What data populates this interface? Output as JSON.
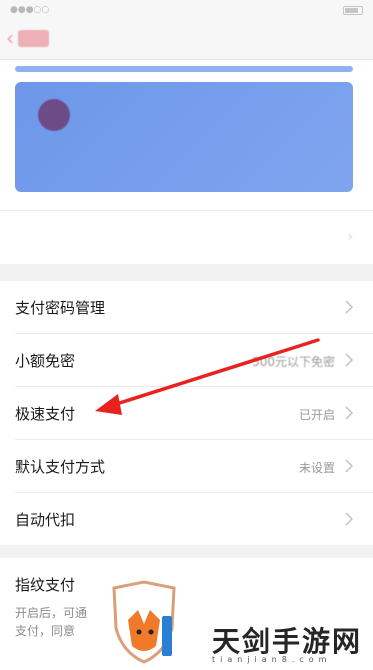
{
  "settings": {
    "rows": [
      {
        "label": "支付密码管理",
        "value": ""
      },
      {
        "label": "小额免密",
        "value": "500元以下免密"
      },
      {
        "label": "极速支付",
        "value": "已开启"
      },
      {
        "label": "默认支付方式",
        "value": "未设置"
      },
      {
        "label": "自动代扣",
        "value": ""
      }
    ]
  },
  "fingerprint": {
    "title": "指纹支付",
    "desc_line1": "开启后，可通",
    "desc_line2": "支付，同意"
  },
  "watermark": {
    "site": "天剑手游网",
    "url": "tianjian8.com"
  },
  "colors": {
    "annotation_arrow": "#e8231f",
    "card_blue": "#7aa1ec",
    "value_gray": "#9a9a9a"
  }
}
